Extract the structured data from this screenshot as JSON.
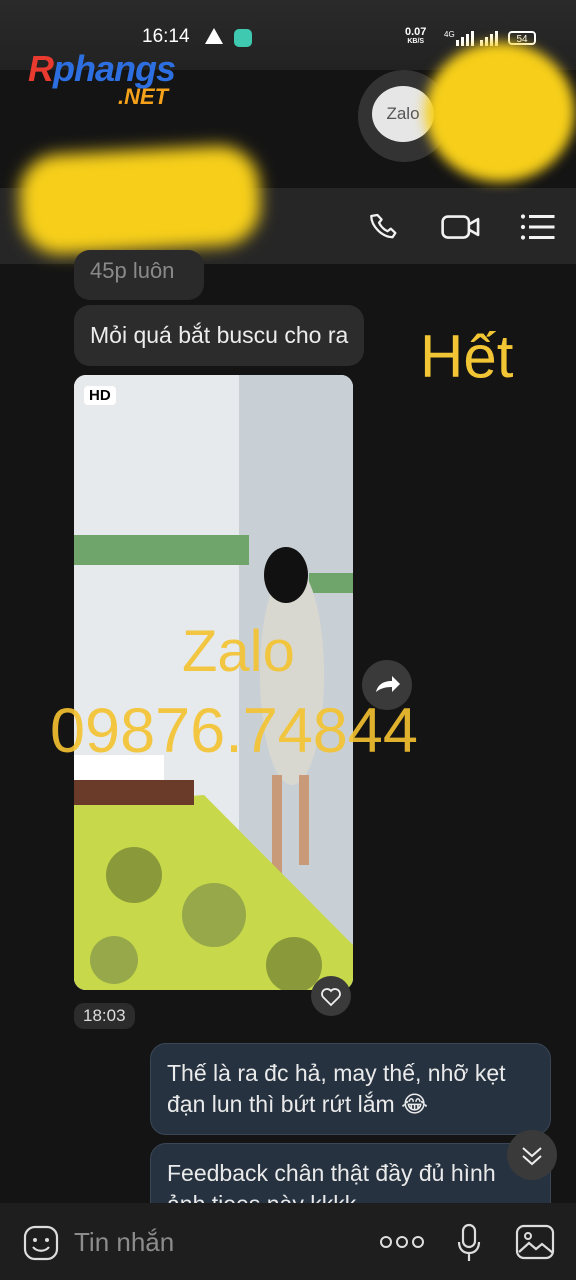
{
  "status": {
    "time": "16:14",
    "net_speed": "0.07",
    "net_unit": "KB/S",
    "net_type": "4G",
    "battery": "54"
  },
  "watermark": {
    "logo_main": "Rphangs",
    "logo_sub": ".NET",
    "zalo_badge": "Zalo"
  },
  "header": {
    "icons": [
      "phone-icon",
      "video-call-icon",
      "menu-icon"
    ]
  },
  "messages": {
    "partial": "45p luôn",
    "msg1": "Mỏi quá bắt buscu cho ra",
    "overlay_text": "Hết",
    "video": {
      "badge": "HD",
      "watermark_line1": "Zalo",
      "watermark_line2": "09876.74844",
      "time": "18:03"
    },
    "out1": "Thế là ra đc hả, may thế, nhỡ kẹt đạn lun thì bứt rứt lắm 😂",
    "out2": "Feedback chân thật đầy đủ hình ảnh tiees này kkkk"
  },
  "composer": {
    "placeholder": "Tin nhắn"
  },
  "colors": {
    "accent_yellow": "#f5c32f",
    "outgoing_bubble": "#263240",
    "incoming_bubble": "#2c2c2c"
  }
}
